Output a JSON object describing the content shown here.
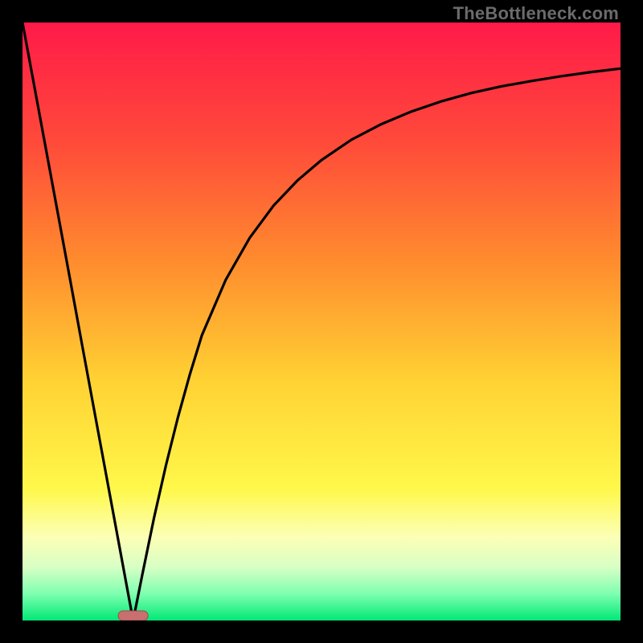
{
  "watermark": "TheBottleneck.com",
  "colors": {
    "frame": "#000000",
    "gradient_stops": [
      {
        "pos": 0.0,
        "color": "#ff1a49"
      },
      {
        "pos": 0.2,
        "color": "#ff4a3a"
      },
      {
        "pos": 0.4,
        "color": "#ff8c2e"
      },
      {
        "pos": 0.6,
        "color": "#ffd233"
      },
      {
        "pos": 0.78,
        "color": "#fff84a"
      },
      {
        "pos": 0.86,
        "color": "#fcffb5"
      },
      {
        "pos": 0.91,
        "color": "#d9ffc5"
      },
      {
        "pos": 0.955,
        "color": "#7fffb0"
      },
      {
        "pos": 1.0,
        "color": "#00e876"
      }
    ],
    "curve": "#000000",
    "marker_fill": "#c96f6f",
    "marker_stroke": "#9e4b4b"
  },
  "chart_data": {
    "type": "line",
    "x": [
      0.0,
      0.02,
      0.04,
      0.06,
      0.08,
      0.1,
      0.12,
      0.14,
      0.16,
      0.18,
      0.185,
      0.2,
      0.22,
      0.24,
      0.26,
      0.28,
      0.3,
      0.34,
      0.38,
      0.42,
      0.46,
      0.5,
      0.55,
      0.6,
      0.65,
      0.7,
      0.75,
      0.8,
      0.85,
      0.9,
      0.95,
      1.0
    ],
    "y": [
      1.0,
      0.892,
      0.784,
      0.676,
      0.568,
      0.459,
      0.351,
      0.243,
      0.135,
      0.027,
      0.0,
      0.075,
      0.172,
      0.26,
      0.34,
      0.412,
      0.477,
      0.57,
      0.64,
      0.694,
      0.736,
      0.77,
      0.804,
      0.83,
      0.851,
      0.868,
      0.882,
      0.893,
      0.902,
      0.91,
      0.917,
      0.923
    ],
    "xlim": [
      0,
      1
    ],
    "ylim": [
      0,
      1
    ],
    "title": "",
    "xlabel": "",
    "ylabel": "",
    "marker": {
      "x_center": 0.185,
      "half_width": 0.025,
      "y": 0.0
    }
  }
}
